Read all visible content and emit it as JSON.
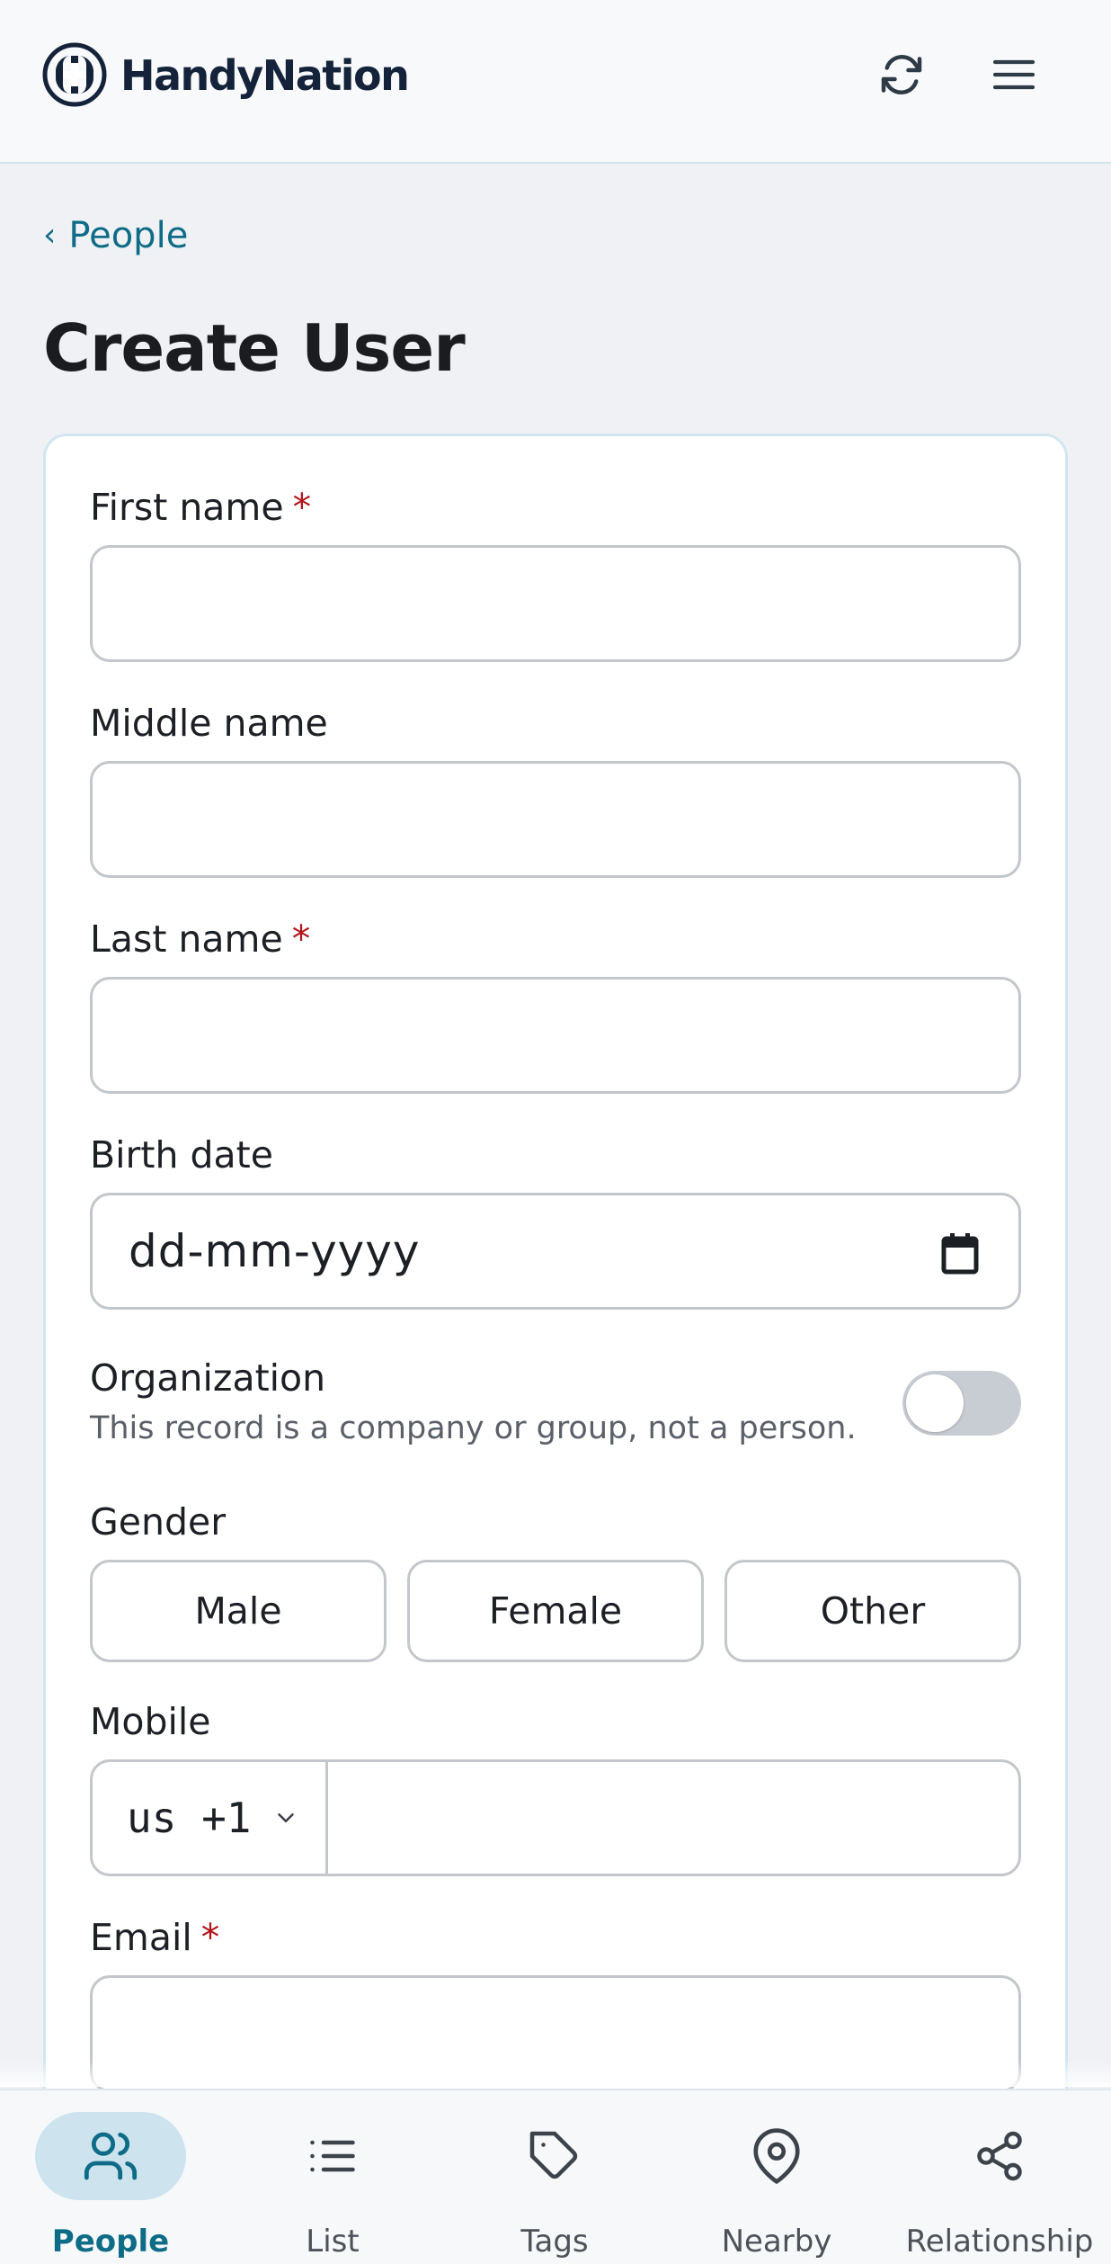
{
  "header": {
    "brand": "HandyNation",
    "icons": {
      "logo": "handynation-logo",
      "refresh": "refresh-icon",
      "menu": "hamburger-menu-icon"
    }
  },
  "breadcrumb": {
    "chevron": "‹",
    "label": "People"
  },
  "page_title": "Create User",
  "form": {
    "first_name": {
      "label": "First name",
      "required_mark": "*",
      "value": ""
    },
    "middle_name": {
      "label": "Middle name",
      "value": ""
    },
    "last_name": {
      "label": "Last name",
      "required_mark": "*",
      "value": ""
    },
    "birth_date": {
      "label": "Birth date",
      "placeholder": "dd-mm-yyyy"
    },
    "organization": {
      "label": "Organization",
      "description": "This record is a company or group, not a person.",
      "checked": false
    },
    "gender": {
      "label": "Gender",
      "options": [
        "Male",
        "Female",
        "Other"
      ]
    },
    "mobile": {
      "label": "Mobile",
      "country_code": "us +1",
      "value": ""
    },
    "email": {
      "label": "Email",
      "required_mark": "*",
      "value": ""
    }
  },
  "bottom_nav": {
    "items": [
      {
        "label": "People",
        "icon": "people-icon",
        "active": true
      },
      {
        "label": "List",
        "icon": "list-icon",
        "active": false
      },
      {
        "label": "Tags",
        "icon": "tag-icon",
        "active": false
      },
      {
        "label": "Nearby",
        "icon": "location-pin-icon",
        "active": false
      },
      {
        "label": "Relationship",
        "icon": "share-nodes-icon",
        "active": false
      }
    ]
  },
  "colors": {
    "accent": "#0f6c87",
    "required": "#b3151b",
    "brand_dark": "#14233a",
    "active_pill": "#cde4ef"
  }
}
